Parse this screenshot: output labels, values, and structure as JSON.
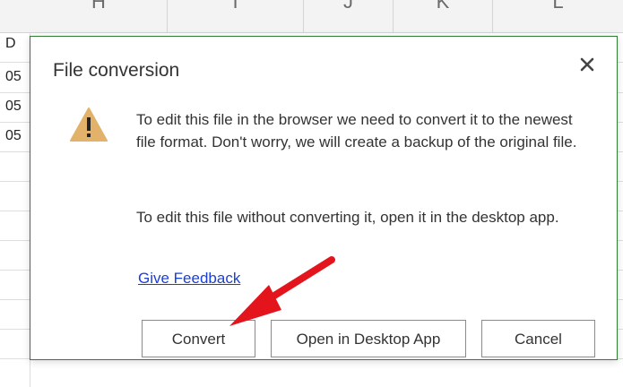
{
  "sheet": {
    "columns": [
      "H",
      "I",
      "J",
      "K",
      "L"
    ],
    "left_cells": [
      "D",
      "05",
      "05",
      "05"
    ]
  },
  "dialog": {
    "title": "File conversion",
    "message_1": "To edit this file in the browser we need to convert it to the newest file format. Don't worry, we will create a backup of the original file.",
    "message_2": "To edit this file without converting it, open it in the desktop app.",
    "link": "Give Feedback",
    "buttons": {
      "convert": "Convert",
      "open_desktop": "Open in Desktop App",
      "cancel": "Cancel"
    },
    "icons": {
      "warning": "warning-triangle-icon",
      "close": "close-icon"
    }
  },
  "colors": {
    "warning_fill": "#e2b26a",
    "dialog_border": "#2e7d32",
    "link": "#1a3fd6",
    "annotation_arrow": "#e3141b"
  }
}
